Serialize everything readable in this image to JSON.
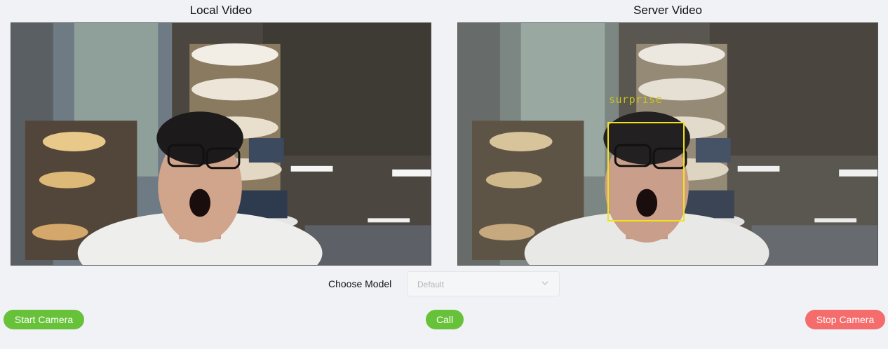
{
  "local_panel": {
    "title": "Local Video"
  },
  "server_panel": {
    "title": "Server Video",
    "detection_label": "surprise",
    "box_color": "#f2e21a"
  },
  "model": {
    "label": "Choose Model",
    "placeholder": "Default"
  },
  "buttons": {
    "start_camera": "Start Camera",
    "call": "Call",
    "stop_camera": "Stop Camera"
  },
  "colors": {
    "success": "#67c23a",
    "danger": "#f56c6c",
    "background": "#f1f2f6"
  }
}
